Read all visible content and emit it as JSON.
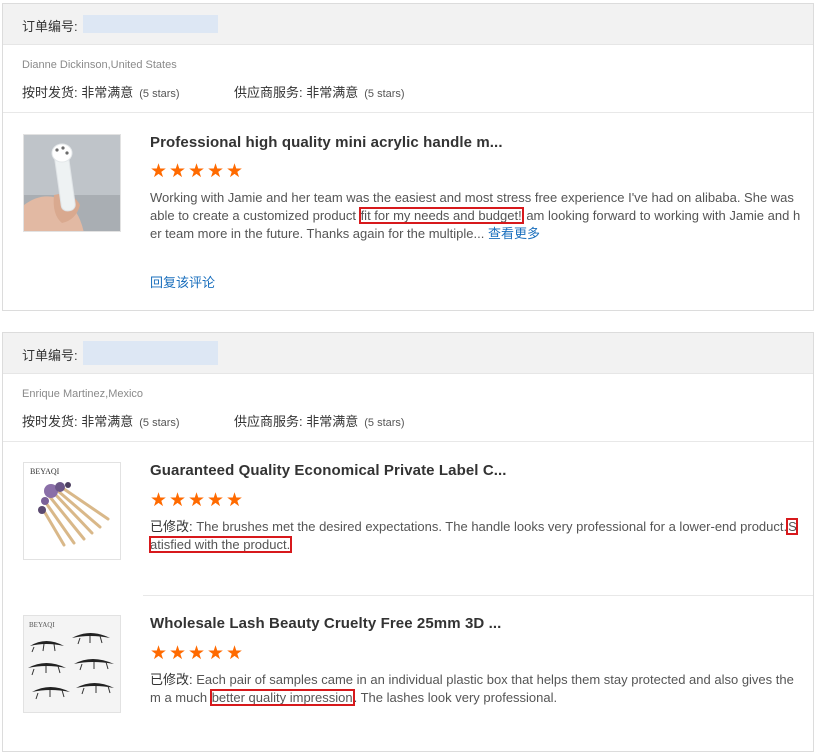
{
  "orders": [
    {
      "order_label": "订单编号:",
      "buyer": "Dianne Dickinson,United States",
      "delivery_label": "按时发货: 非常满意",
      "delivery_stars": "(5 stars)",
      "service_label": "供应商服务: 非常满意",
      "service_stars": "(5 stars)",
      "items": [
        {
          "title": "Professional high quality mini acrylic handle m...",
          "rating": 5,
          "text_before": "Working with Jamie and her team was the easiest and most stress free experience I've had on alibaba. She was able to create a customized product ",
          "highlight": "fit for my needs and budget!",
          "text_after": " am looking forward to working with Jamie and her team more in the future. Thanks again for the multiple...",
          "more_label": "查看更多",
          "reply_label": "回复该评论"
        }
      ]
    },
    {
      "order_label": "订单编号:",
      "buyer": "Enrique Martinez,Mexico",
      "delivery_label": "按时发货: 非常满意",
      "delivery_stars": "(5 stars)",
      "service_label": "供应商服务: 非常满意",
      "service_stars": "(5 stars)",
      "items": [
        {
          "title": "Guaranteed Quality Economical Private Label C...",
          "rating": 5,
          "edited_label": "已修改:",
          "text_before": " The brushes met the desired expectations. The handle looks very professional for a lower-end product.",
          "highlight": "Satisfied with the product.",
          "text_after": "",
          "brand": "BEYAQI"
        },
        {
          "title": "Wholesale Lash Beauty Cruelty Free 25mm 3D ...",
          "rating": 5,
          "edited_label": "已修改:",
          "text_before": " Each pair of samples came in an individual plastic box that helps them stay protected and also gives them a much ",
          "highlight": "better quality impression",
          "text_after": ". The lashes look very professional.",
          "brand": "BEYAQI"
        }
      ]
    }
  ],
  "colors": {
    "star": "#ff6a00",
    "link": "#1a6fbd",
    "highlight_border": "#d7191c",
    "header_bg": "#f2f2f2"
  }
}
